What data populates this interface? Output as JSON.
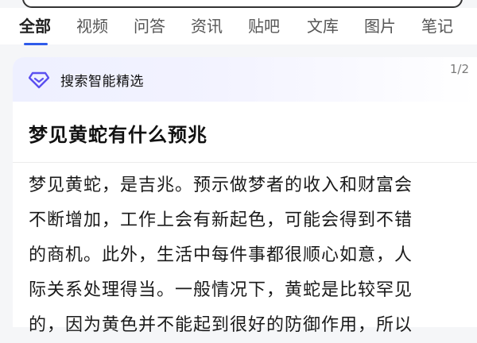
{
  "tabs": [
    {
      "label": "全部",
      "active": true
    },
    {
      "label": "视频",
      "active": false
    },
    {
      "label": "问答",
      "active": false
    },
    {
      "label": "资讯",
      "active": false
    },
    {
      "label": "贴吧",
      "active": false
    },
    {
      "label": "文库",
      "active": false
    },
    {
      "label": "图片",
      "active": false
    },
    {
      "label": "笔记",
      "active": false
    }
  ],
  "card": {
    "icon": "diamond-icon",
    "label": "搜索智能精选",
    "page_indicator": "1/2",
    "question": "梦见黄蛇有什么预兆",
    "answer_lines": [
      "梦见黄蛇，是吉兆。预示做梦者的收入和财富会",
      "不断增加，工作上会有新起色，可能会得到不错",
      "的商机。此外，生活中每件事都很顺心如意，人",
      "际关系处理得当。一般情况下，黄蛇是比较罕见",
      "的，因为黄色并不能起到很好的防御作用，所以"
    ]
  },
  "colors": {
    "accent": "#2f5bea",
    "icon_purple": "#5b4ff0"
  }
}
